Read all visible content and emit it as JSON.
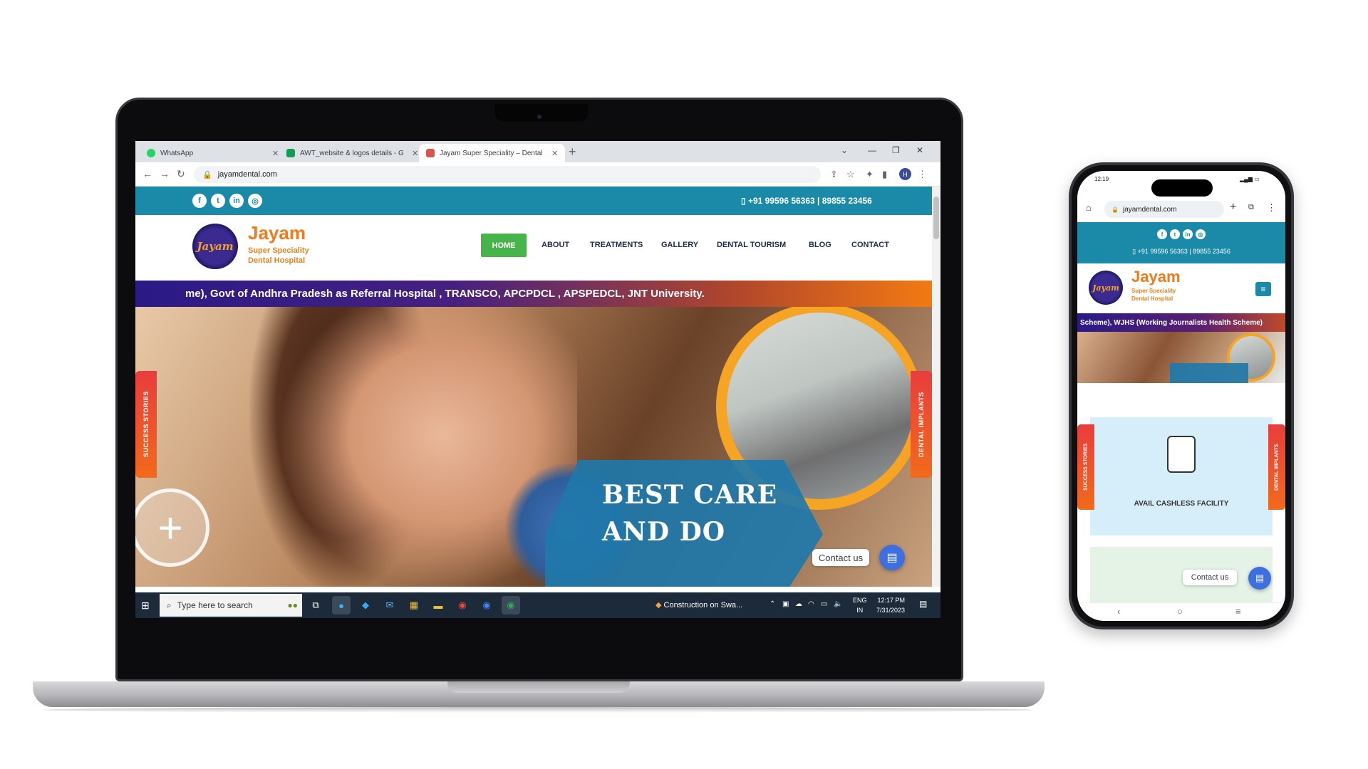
{
  "browser": {
    "tabs": [
      {
        "title": "WhatsApp",
        "color": "#25d366"
      },
      {
        "title": "AWT_website & logos details - G",
        "color": "#0f9d58"
      },
      {
        "title": "Jayam Super Speciality – Dental",
        "color": "#d9534f"
      }
    ],
    "new_tab": "+",
    "url": "jayamdental.com"
  },
  "site": {
    "phone_numbers": "+91 99596 56363 | 89855 23456",
    "logo": {
      "mark": "Jayam",
      "name": "Jayam",
      "sub1": "Super Speciality",
      "sub2": "Dental Hospital"
    },
    "menu": [
      "HOME",
      "ABOUT",
      "TREATMENTS",
      "GALLERY",
      "DENTAL TOURISM",
      "BLOG",
      "CONTACT"
    ],
    "ticker": "me), Govt of Andhra Pradesh as Referral Hospital , TRANSCO, APCPDCL , APSPEDCL, JNT University.",
    "hero_line1": "BEST CARE",
    "hero_line2": "AND DO",
    "left_tab": "SUCCESS STORIES",
    "right_tab": "DENTAL IMPLANTS",
    "contact_label": "Contact us",
    "colors": {
      "primary": "#1b8aa8",
      "accent": "#46b44a",
      "orange": "#f07a1c"
    }
  },
  "taskbar": {
    "search_placeholder": "Type here to search",
    "notification": "Construction on Swa...",
    "lang": "ENG",
    "region": "IN",
    "time": "12:17 PM",
    "date": "7/31/2023"
  },
  "mobile": {
    "status_time": "12:19",
    "url": "jayamdental.com",
    "phone_numbers": "+91 99596 56363 | 89855 23456",
    "ticker": "Scheme), WJHS (Working Journalists Health Scheme)",
    "card_title": "AVAIL CASHLESS FACILITY",
    "left_tab": "SUCCESS STORIES",
    "right_tab": "DENTAL IMPLANTS",
    "contact_label": "Contact us"
  }
}
